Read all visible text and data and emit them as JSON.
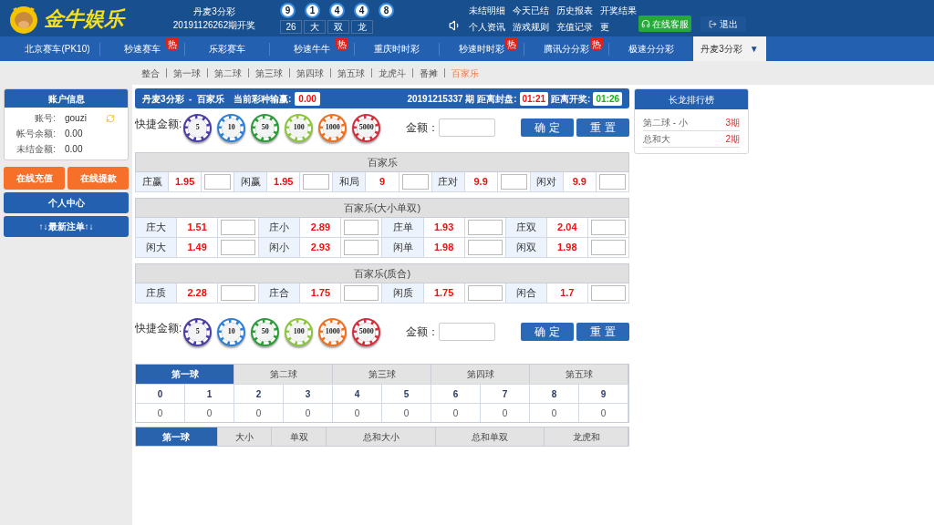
{
  "header": {
    "logo_text": "金牛娱乐",
    "lottery_name": "丹麦3分彩",
    "draw_period": "20191126262期开奖",
    "balls": [
      "9",
      "1",
      "4",
      "4",
      "8"
    ],
    "stats": [
      "26",
      "大",
      "双",
      "龙"
    ],
    "links": [
      [
        "未结明细",
        "今天已结",
        "历史报表",
        "开奖结果"
      ],
      [
        "个人资讯",
        "游戏规则",
        "充值记录",
        "更"
      ]
    ],
    "service_button": "在线客服",
    "logout_button": "退出"
  },
  "nav": [
    {
      "label": "北京赛车(PK10)",
      "selected": false
    },
    {
      "label": "秒速赛车",
      "selected": false,
      "badge": "热"
    },
    {
      "label": "乐彩赛车",
      "selected": false
    },
    {
      "label": "秒速牛牛",
      "selected": false,
      "badge": "热"
    },
    {
      "label": "重庆时时彩",
      "selected": false
    },
    {
      "label": "秒速时时彩",
      "selected": false,
      "badge": "热"
    },
    {
      "label": "腾讯分分彩",
      "selected": false,
      "badge": "热"
    },
    {
      "label": "极速分分彩",
      "selected": false
    },
    {
      "label": "丹麦3分彩",
      "selected": true,
      "caret": "▼"
    }
  ],
  "subnav": [
    {
      "label": "整合",
      "selected": false
    },
    {
      "label": "第一球",
      "selected": false
    },
    {
      "label": "第二球",
      "selected": false
    },
    {
      "label": "第三球",
      "selected": false
    },
    {
      "label": "第四球",
      "selected": false
    },
    {
      "label": "第五球",
      "selected": false
    },
    {
      "label": "龙虎斗",
      "selected": false
    },
    {
      "label": "番摊",
      "selected": false
    },
    {
      "label": "百家乐",
      "selected": true
    }
  ],
  "sidebar": {
    "account_title": "账户信息",
    "account_rows": [
      {
        "label": "账号:",
        "value": "gouzi"
      },
      {
        "label": "帐号余额:",
        "value": "0.00"
      },
      {
        "label": "未结金额:",
        "value": "0.00"
      }
    ],
    "deposit_button": "在线充值",
    "withdraw_button": "在线提款",
    "personal_center": "个人中心",
    "latest_bets": "↑↓最新注单↑↓"
  },
  "title_bar": {
    "game": "丹麦3分彩  -  百家乐",
    "pnl_label": "当前彩种输赢:",
    "pnl": "0.00",
    "period": "20191215337 期 距离封盘:",
    "close_time": "01:21",
    "draw_label": "距离开奖:",
    "draw_time": "01:26"
  },
  "quick_bets": [
    {
      "label": "快捷金额:",
      "amount_label": "金额：",
      "confirm": "确 定",
      "reset": "重 置",
      "chips": [
        {
          "value": "5",
          "color": "#4b3fa6"
        },
        {
          "value": "10",
          "color": "#2f80d8"
        },
        {
          "value": "50",
          "color": "#2e9b3a"
        },
        {
          "value": "100",
          "color": "#8cc63f"
        },
        {
          "value": "1000",
          "color": "#f07020"
        },
        {
          "value": "5000",
          "color": "#d2303c"
        }
      ]
    },
    {
      "label": "快捷金额:",
      "amount_label": "金额：",
      "confirm": "确 定",
      "reset": "重 置",
      "chips": [
        {
          "value": "5",
          "color": "#4b3fa6"
        },
        {
          "value": "10",
          "color": "#2f80d8"
        },
        {
          "value": "50",
          "color": "#2e9b3a"
        },
        {
          "value": "100",
          "color": "#8cc63f"
        },
        {
          "value": "1000",
          "color": "#f07020"
        },
        {
          "value": "5000",
          "color": "#d2303c"
        }
      ]
    }
  ],
  "sections": [
    {
      "title": "百家乐",
      "rows": [
        [
          {
            "label": "庄赢",
            "odds": "1.95"
          },
          {
            "label": "闲赢",
            "odds": "1.95"
          },
          {
            "label": "和局",
            "odds": "9"
          },
          {
            "label": "庄对",
            "odds": "9.9"
          },
          {
            "label": "闲对",
            "odds": "9.9"
          }
        ]
      ]
    },
    {
      "title": "百家乐(大小单双)",
      "rows": [
        [
          {
            "label": "庄大",
            "odds": "1.51"
          },
          {
            "label": "庄小",
            "odds": "2.89"
          },
          {
            "label": "庄单",
            "odds": "1.93"
          },
          {
            "label": "庄双",
            "odds": "2.04"
          }
        ],
        [
          {
            "label": "闲大",
            "odds": "1.49"
          },
          {
            "label": "闲小",
            "odds": "2.93"
          },
          {
            "label": "闲单",
            "odds": "1.98"
          },
          {
            "label": "闲双",
            "odds": "1.98"
          }
        ]
      ]
    },
    {
      "title": "百家乐(质合)",
      "rows": [
        [
          {
            "label": "庄质",
            "odds": "2.28"
          },
          {
            "label": "庄合",
            "odds": "1.75"
          },
          {
            "label": "闲质",
            "odds": "1.75"
          },
          {
            "label": "闲合",
            "odds": "1.7"
          }
        ]
      ]
    }
  ],
  "ball_tabs": [
    {
      "label": "第一球",
      "selected": true
    },
    {
      "label": "第二球",
      "selected": false
    },
    {
      "label": "第三球",
      "selected": false
    },
    {
      "label": "第四球",
      "selected": false
    },
    {
      "label": "第五球",
      "selected": false
    }
  ],
  "numbers": [
    {
      "number": "0",
      "count": "0"
    },
    {
      "number": "1",
      "count": "0"
    },
    {
      "number": "2",
      "count": "0"
    },
    {
      "number": "3",
      "count": "0"
    },
    {
      "number": "4",
      "count": "0"
    },
    {
      "number": "5",
      "count": "0"
    },
    {
      "number": "6",
      "count": "0"
    },
    {
      "number": "7",
      "count": "0"
    },
    {
      "number": "8",
      "count": "0"
    },
    {
      "number": "9",
      "count": "0"
    }
  ],
  "stat_tabs": [
    {
      "label": "第一球",
      "selected": true
    },
    {
      "label": "大小",
      "selected": false
    },
    {
      "label": "单双",
      "selected": false
    },
    {
      "label": "总和大小",
      "selected": false
    },
    {
      "label": "总和单双",
      "selected": false
    },
    {
      "label": "龙虎和",
      "selected": false
    }
  ],
  "ranking": {
    "title": "长龙排行榜",
    "rows": [
      {
        "label": "第二球 - 小",
        "value": "3期"
      },
      {
        "label": "总和大",
        "value": "2期"
      }
    ]
  }
}
